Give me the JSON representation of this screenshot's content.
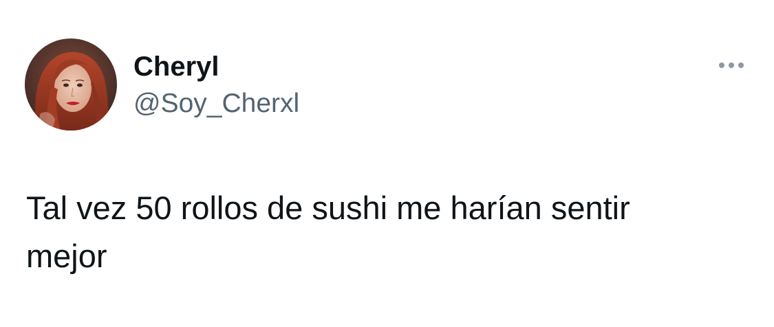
{
  "author": {
    "display_name": "Cheryl",
    "handle": "@Soy_Cherxl",
    "avatar": "profile-photo"
  },
  "more_menu": {
    "icon": "more-horizontal-icon"
  },
  "tweet": {
    "text": "Tal vez 50 rollos de sushi me harían sentir\nmejor"
  },
  "colors": {
    "background": "#ffffff",
    "text_primary": "#0f1419",
    "text_secondary": "#536471",
    "icon_muted": "#8b98a5"
  }
}
